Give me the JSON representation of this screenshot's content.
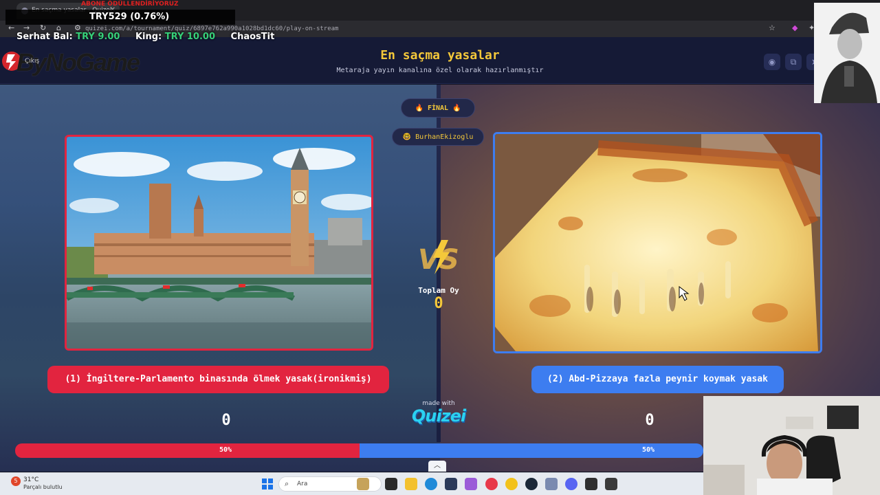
{
  "browser": {
    "tab_title": "En saçma yasalar - Quizei",
    "url": "quizei.com/a/tournament/quiz/6897e762a990a1028bd1dc60/play-on-stream"
  },
  "overlay": {
    "ticker": "TRY529 (0.76%)",
    "ticker_red": "ABONE ÖDÜLLENDİRİYORUZ",
    "prices": [
      {
        "label": "Serhat Bal:",
        "value": "TRY 9.00"
      },
      {
        "label": "King:",
        "value": "TRY 10.00"
      },
      {
        "label": "ChaosTit",
        "value": ""
      }
    ],
    "logo": "ByNoGame",
    "logo_faint": "Çıkış"
  },
  "header": {
    "title": "En saçma yasalar",
    "subtitle": "Metaraja yayın kanalına özel olarak hazırlanmıştır"
  },
  "round": {
    "stage": "🔥 FİNAL 🔥",
    "user": "🤓 BurhanEkizoglu",
    "total_label": "Toplam Oy",
    "total_votes": "0"
  },
  "options": [
    {
      "label": "(1) İngiltere-Parlamento binasında ölmek yasak(ironikmiş)",
      "score": "0",
      "percent_text": "50%",
      "percent": 50,
      "color": "#e2243f"
    },
    {
      "label": "(2) Abd-Pizzaya fazla peynir koymak yasak",
      "score": "0",
      "percent_text": "50%",
      "percent": 50,
      "color": "#3d7df0"
    }
  ],
  "footer": {
    "made_with": "made with",
    "brand": "Quizei"
  },
  "taskbar": {
    "temp": "31°C",
    "weather": "Parçalı bulutlu",
    "badge": "5",
    "search_placeholder": "Ara"
  }
}
